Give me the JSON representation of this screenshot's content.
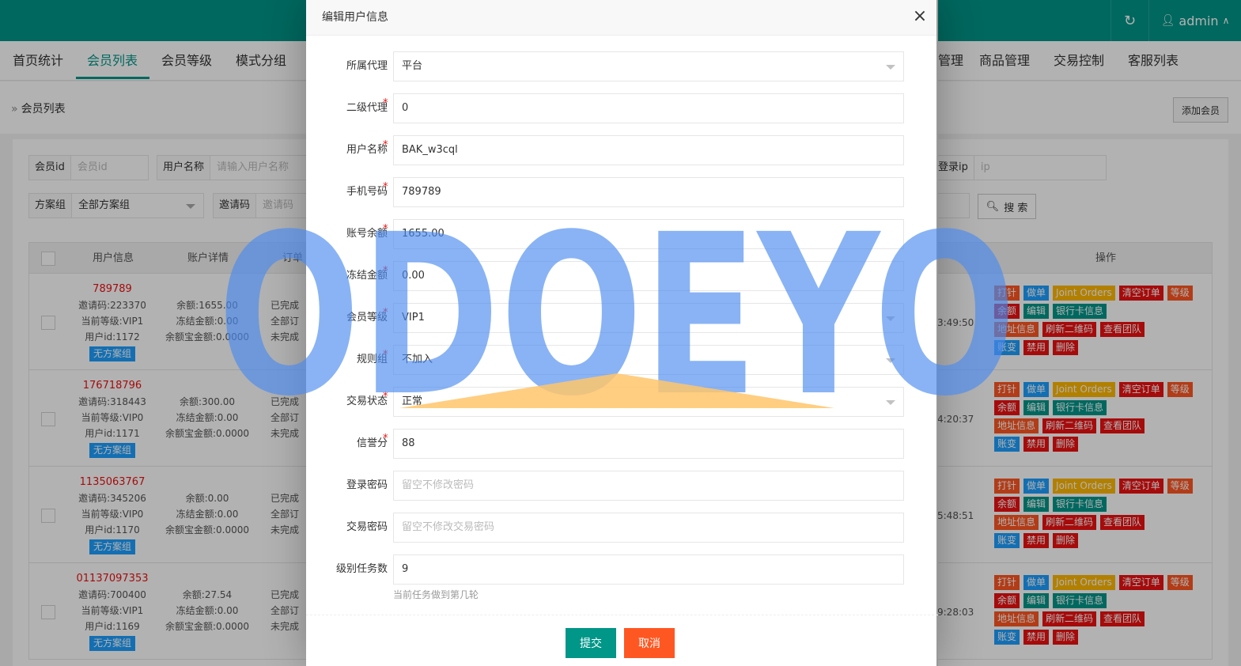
{
  "header": {
    "user": "admin",
    "colors": {
      "primary": "#009688",
      "danger": "#FF5722",
      "info": "#1E9FFF",
      "warn": "#FFB800"
    }
  },
  "nav": {
    "items": [
      "首页统计",
      "会员列表",
      "会员等级",
      "模式分组",
      "管理",
      "商品管理",
      "交易控制",
      "客服列表"
    ],
    "active": "会员列表"
  },
  "breadcrumb": {
    "sep": "»",
    "current": "会员列表"
  },
  "toolbar": {
    "add_member": "添加会员",
    "search": "搜 索"
  },
  "filters": {
    "member_id": {
      "label": "会员id",
      "placeholder": "会员id"
    },
    "username": {
      "label": "用户名称",
      "placeholder": "请输入用户名称"
    },
    "login_ip": {
      "label": "登录ip",
      "placeholder": "ip"
    },
    "plan_group": {
      "label": "方案组",
      "value": "全部方案组"
    },
    "invite_code": {
      "label": "邀请码",
      "placeholder": "邀请码"
    }
  },
  "table": {
    "headers": {
      "user": "用户信息",
      "account": "账户详情",
      "orders": "订单",
      "ops": "操作"
    },
    "rows": [
      {
        "phone": "789789",
        "invite": "邀请码:223370",
        "level": "当前等级:VIP1",
        "uid": "用户id:1172",
        "group": "无方案组",
        "balance": "余额:1655.00",
        "frozen": "冻结金额:0.00",
        "bao": "余额宝金额:0.0000",
        "o1": "已完成",
        "o2": "全部订",
        "o3": "未完成",
        "time": "3:49:50"
      },
      {
        "phone": "176718796",
        "invite": "邀请码:318443",
        "level": "当前等级:VIP0",
        "uid": "用户id:1171",
        "group": "无方案组",
        "balance": "余额:300.00",
        "frozen": "冻结金额:0.00",
        "bao": "余额宝金额:0.0000",
        "o1": "已完成",
        "o2": "全部订",
        "o3": "未完成",
        "time": "4:20:37"
      },
      {
        "phone": "1135063767",
        "invite": "邀请码:345206",
        "level": "当前等级:VIP0",
        "uid": "用户id:1170",
        "group": "无方案组",
        "balance": "余额:0.00",
        "frozen": "冻结金额:0.00",
        "bao": "余额宝金额:0.0000",
        "o1": "已完成",
        "o2": "全部订",
        "o3": "未完成",
        "time": "5:48:51"
      },
      {
        "phone": "01137097353",
        "invite": "邀请码:700400",
        "level": "当前等级:VIP1",
        "uid": "用户id:1169",
        "group": "无方案组",
        "balance": "余额:27.54",
        "frozen": "冻结金额:0.00",
        "bao": "余额宝金额:0.0000",
        "o1": "已完成",
        "o2": "全部订",
        "o3": "未完成",
        "time": "9:28:03"
      }
    ],
    "ops": {
      "row1": [
        "打针",
        "做单",
        "Joint Orders",
        "清空订单",
        "等级"
      ],
      "row2": [
        "余额",
        "编辑",
        "银行卡信息"
      ],
      "row3": [
        "地址信息",
        "刷新二维码",
        "查看团队"
      ],
      "row4": [
        "账变",
        "禁用",
        "删除"
      ]
    }
  },
  "modal": {
    "title": "编辑用户信息",
    "close": "×",
    "fields": [
      {
        "label": "所属代理",
        "value": "平台",
        "required": false,
        "select": true
      },
      {
        "label": "二级代理",
        "value": "0",
        "required": true,
        "select": false
      },
      {
        "label": "用户名称",
        "value": "BAK_w3cql",
        "required": true,
        "select": false
      },
      {
        "label": "手机号码",
        "value": "789789",
        "required": true,
        "select": false
      },
      {
        "label": "账号余额",
        "value": "1655.00",
        "required": true,
        "select": false
      },
      {
        "label": "冻结金额",
        "value": "0.00",
        "required": true,
        "select": false
      },
      {
        "label": "会员等级",
        "value": "VIP1",
        "required": true,
        "select": true
      },
      {
        "label": "规则组",
        "value": "不加入",
        "required": true,
        "select": true
      },
      {
        "label": "交易状态",
        "value": "正常",
        "required": true,
        "select": true
      },
      {
        "label": "信誉分",
        "value": "88",
        "required": true,
        "select": false
      },
      {
        "label": "登录密码",
        "placeholder": "留空不修改密码",
        "required": false,
        "select": false
      },
      {
        "label": "交易密码",
        "placeholder": "留空不修改交易密码",
        "required": false,
        "select": false
      },
      {
        "label": "级别任务数",
        "value": "9",
        "required": false,
        "select": false
      }
    ],
    "task_hint": "当前任务做到第几轮",
    "submit": "提交",
    "cancel": "取消"
  },
  "watermark": {
    "text": "ODOEYO",
    "color": "#4A8BEF"
  }
}
